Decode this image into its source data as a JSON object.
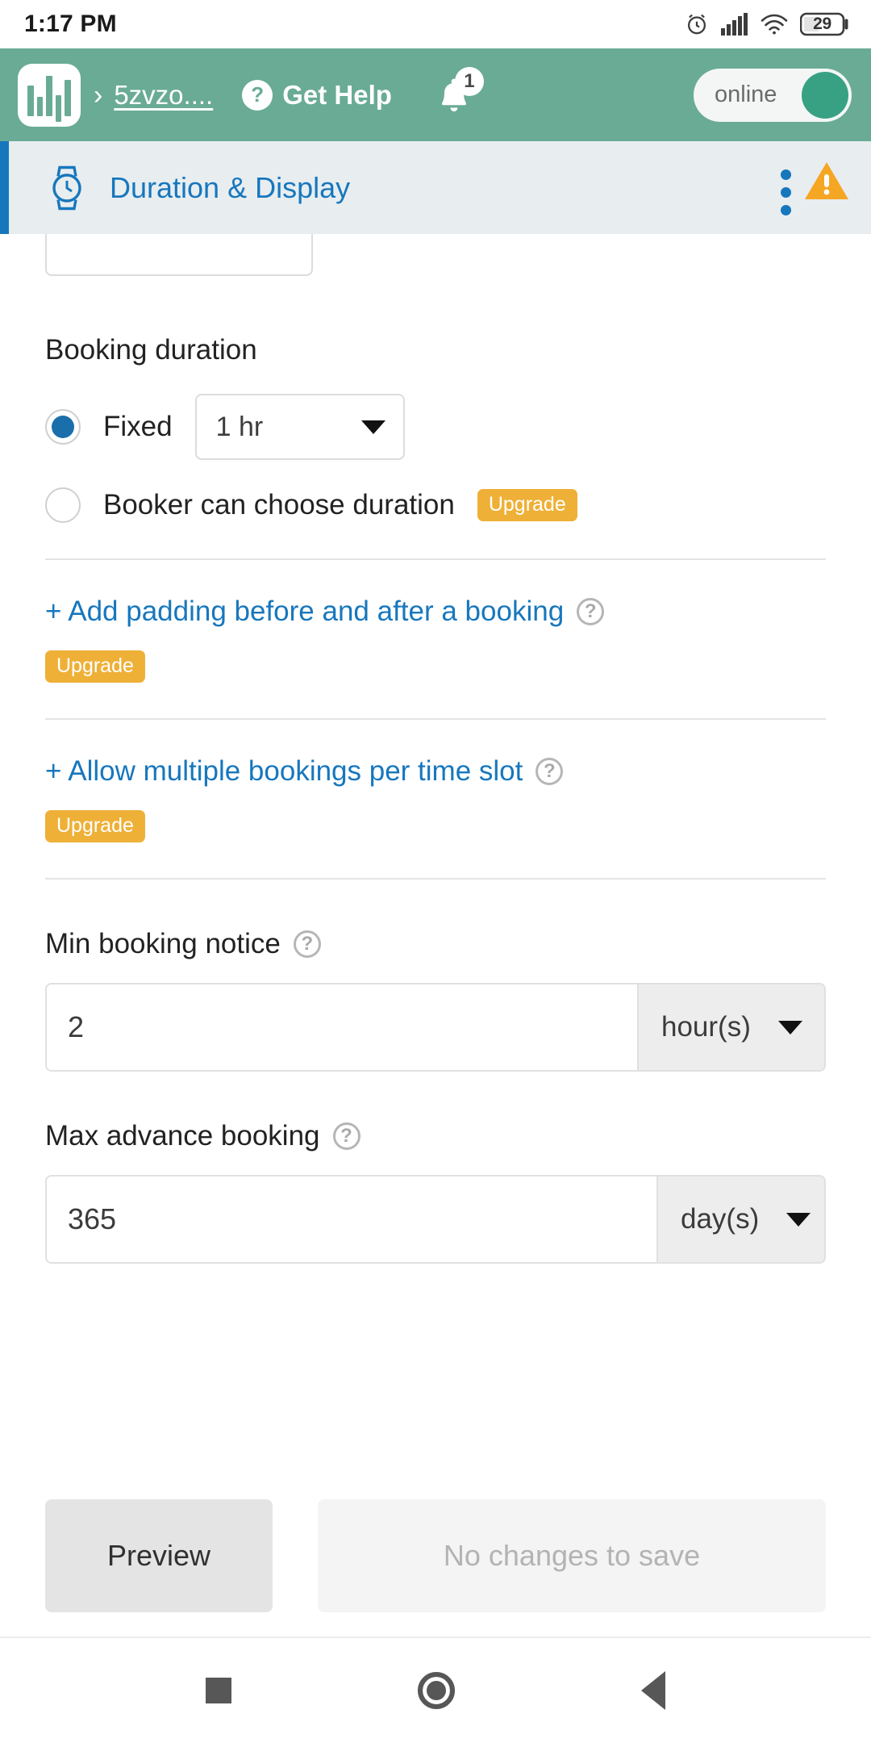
{
  "status_bar": {
    "time": "1:17 PM",
    "battery_percent": "29",
    "icons": [
      "alarm-icon",
      "cellular-signal-icon",
      "wifi-icon",
      "battery-icon"
    ]
  },
  "app_bar": {
    "logo_name": "app-logo",
    "breadcrumb_separator": "›",
    "breadcrumb_link": "5zvzo....",
    "help_icon_glyph": "?",
    "help_label": "Get Help",
    "notification_count": "1",
    "online_label": "online"
  },
  "section_header": {
    "icon": "watch-icon",
    "title": "Duration & Display",
    "menu_icon": "kebab-menu-icon",
    "warning_icon": "warning-triangle-icon"
  },
  "form": {
    "booking_duration": {
      "label": "Booking duration",
      "options": [
        {
          "label": "Fixed",
          "selected": true,
          "value": "1 hr"
        },
        {
          "label": "Booker can choose duration",
          "selected": false,
          "badge": "Upgrade"
        }
      ]
    },
    "padding_link": {
      "label": "+ Add padding before and after a booking",
      "help_glyph": "?",
      "badge": "Upgrade"
    },
    "multiple_bookings_link": {
      "label": "+ Allow multiple bookings per time slot",
      "help_glyph": "?",
      "badge": "Upgrade"
    },
    "min_booking_notice": {
      "label": "Min booking notice",
      "help_glyph": "?",
      "value": "2",
      "unit": "hour(s)"
    },
    "max_advance_booking": {
      "label": "Max advance booking",
      "help_glyph": "?",
      "value": "365",
      "unit": "day(s)"
    }
  },
  "action_bar": {
    "preview_label": "Preview",
    "save_label": "No changes to save"
  },
  "nav_bar": {
    "recents": "recents-square-icon",
    "home": "home-circle-icon",
    "back": "back-triangle-icon"
  },
  "colors": {
    "app_bar_green": "#6aab96",
    "accent_blue": "#1777bd",
    "upgrade_amber": "#eeb037",
    "section_bg": "#e8edf0",
    "warning_orange": "#f5a623"
  }
}
